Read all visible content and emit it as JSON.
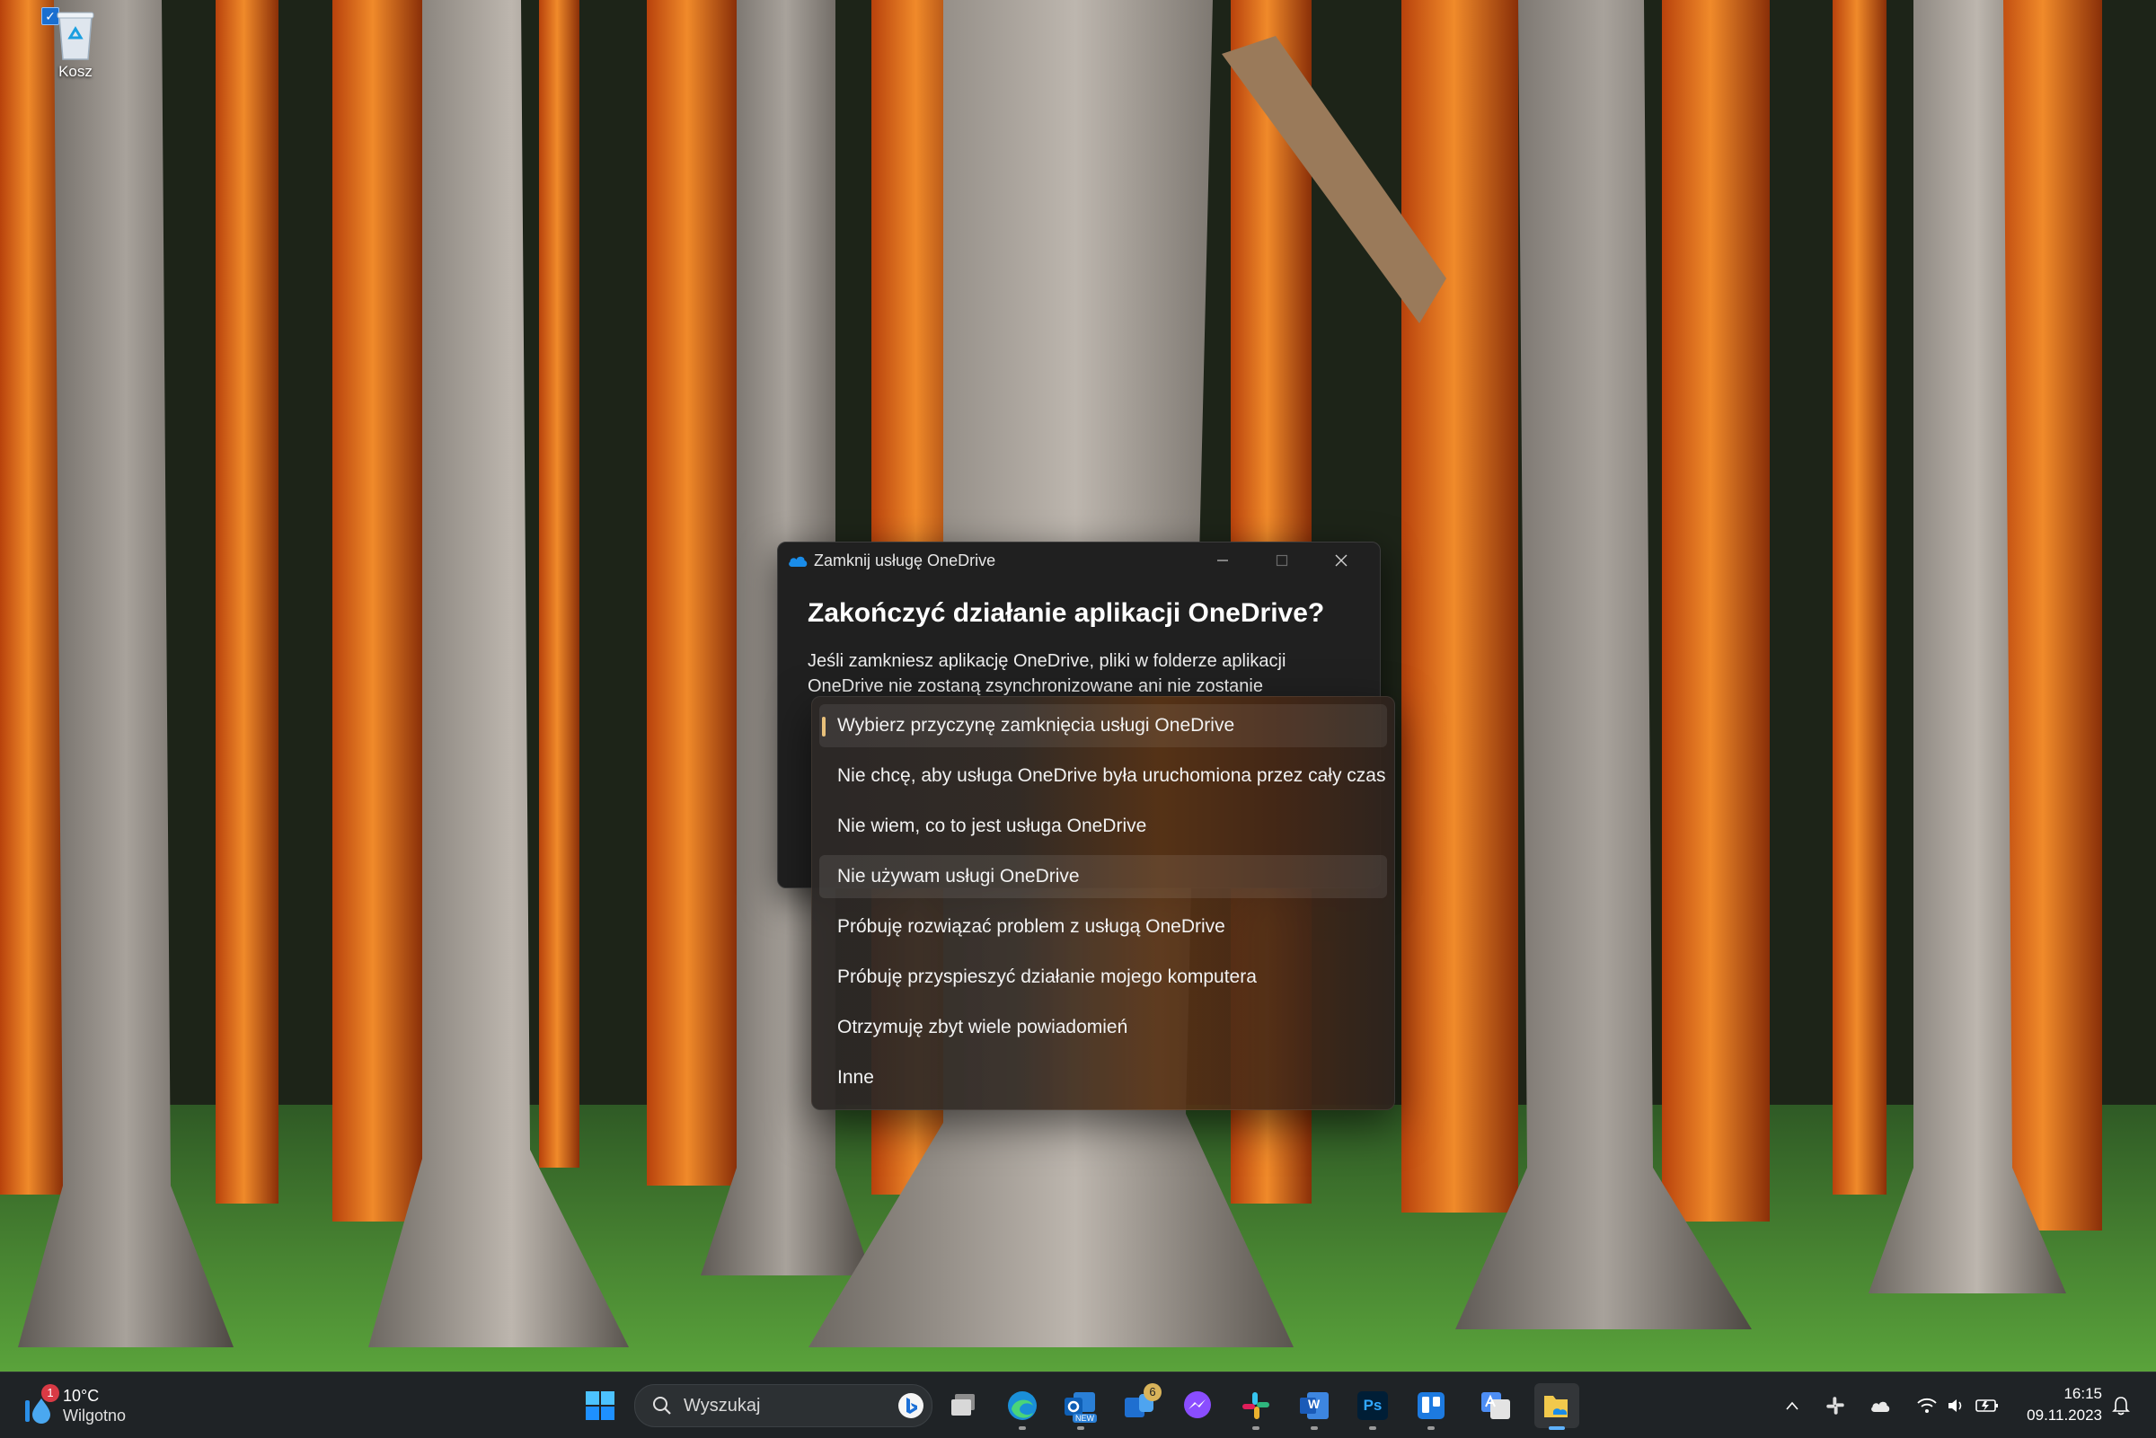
{
  "desktop": {
    "recycle_bin_label": "Kosz"
  },
  "dialog": {
    "window_title": "Zamknij usługę OneDrive",
    "heading": "Zakończyć działanie aplikacji OneDrive?",
    "description": "Jeśli zamkniesz aplikację OneDrive, pliki w folderze aplikacji OneDrive nie zostaną zsynchronizowane ani nie zostanie"
  },
  "dropdown": {
    "items": [
      {
        "label": "Wybierz przyczynę zamknięcia usługi OneDrive",
        "state": "selected"
      },
      {
        "label": "Nie chcę, aby usługa OneDrive była uruchomiona przez cały czas",
        "state": "normal"
      },
      {
        "label": "Nie wiem, co to jest usługa OneDrive",
        "state": "normal"
      },
      {
        "label": "Nie używam usługi OneDrive",
        "state": "hover"
      },
      {
        "label": "Próbuję rozwiązać problem z usługą OneDrive",
        "state": "normal"
      },
      {
        "label": "Próbuję przyspieszyć działanie mojego komputera",
        "state": "normal"
      },
      {
        "label": "Otrzymuję zbyt wiele powiadomień",
        "state": "normal"
      },
      {
        "label": "Inne",
        "state": "normal"
      }
    ]
  },
  "taskbar": {
    "weather": {
      "temp": "10°C",
      "condition": "Wilgotno",
      "badge": "1"
    },
    "search_placeholder": "Wyszukaj",
    "teams_badge": "6",
    "outlook_badge": "NEW",
    "photoshop_label": "Ps",
    "word_label": "W",
    "clock": {
      "time": "16:15",
      "date": "09.11.2023"
    }
  },
  "colors": {
    "accent": "#e8c07a",
    "dialog_bg": "#202020",
    "taskbar_bg": "#1f2326",
    "active_indicator": "#5fb2ff"
  }
}
